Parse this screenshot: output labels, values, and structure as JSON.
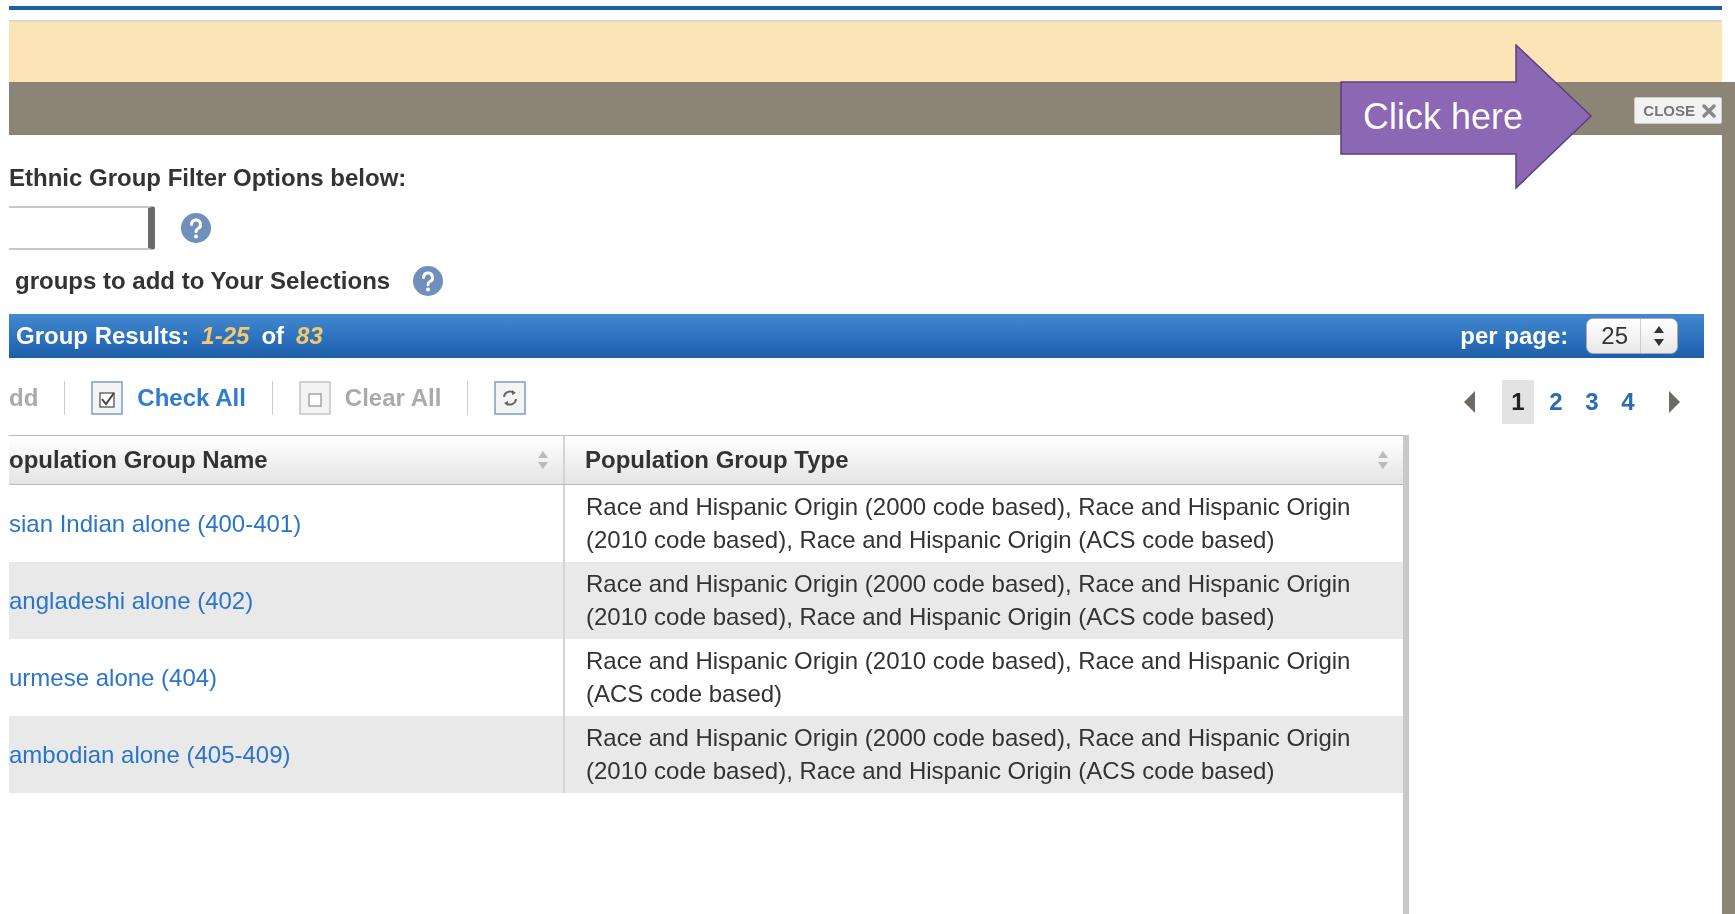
{
  "dialog": {
    "close_label": "CLOSE"
  },
  "callout": {
    "text": "Click here"
  },
  "filter": {
    "heading": "Ethnic Group Filter Options below:"
  },
  "instruction": "groups to add to Your Selections",
  "results": {
    "label": "Group Results:",
    "range": "1-25",
    "of": "of",
    "total": "83",
    "per_page_label": "per page:",
    "per_page": "25"
  },
  "toolbar": [
    {
      "kind": "add",
      "label": "dd",
      "disabled": true
    },
    {
      "kind": "check_all",
      "label": "Check All",
      "disabled": false
    },
    {
      "kind": "clear_all",
      "label": "Clear All",
      "disabled": true
    },
    {
      "kind": "refresh"
    }
  ],
  "pagination": {
    "pages": [
      {
        "label": "1",
        "selected": true
      },
      {
        "label": "2",
        "selected": false
      },
      {
        "label": "3",
        "selected": false
      },
      {
        "label": "4",
        "selected": false
      }
    ]
  },
  "table": {
    "columns": [
      {
        "label": "opulation Group Name"
      },
      {
        "label": "Population Group Type"
      }
    ],
    "rows": [
      {
        "name": "sian Indian alone (400-401)",
        "type": "Race and Hispanic Origin (2000 code based), Race and Hispanic Origin (2010 code based), Race and Hispanic Origin (ACS code based)"
      },
      {
        "name": "angladeshi alone (402)",
        "type": "Race and Hispanic Origin (2000 code based), Race and Hispanic Origin (2010 code based), Race and Hispanic Origin (ACS code based)"
      },
      {
        "name": "urmese alone (404)",
        "type": "Race and Hispanic Origin (2010 code based), Race and Hispanic Origin (ACS code based)"
      },
      {
        "name": "ambodian alone (405-409)",
        "type": "Race and Hispanic Origin (2000 code based), Race and Hispanic Origin (2010 code based), Race and Hispanic Origin (ACS code based)"
      }
    ]
  }
}
